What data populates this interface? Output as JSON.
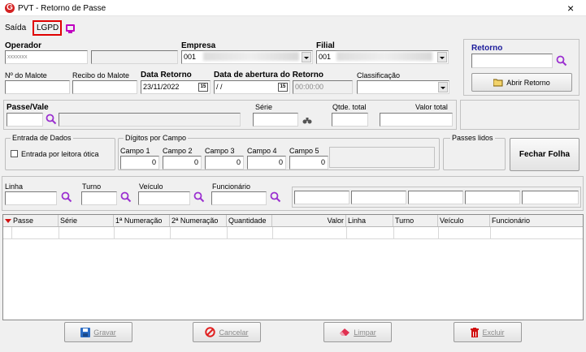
{
  "window": {
    "title": "PVT - Retorno de Passe",
    "close": "×"
  },
  "menu": {
    "saida": "Saída",
    "lgpd": "LGPD"
  },
  "operador": {
    "label": "Operador",
    "value": "xxxxxxx"
  },
  "empresa": {
    "label": "Empresa",
    "value": "001"
  },
  "filial": {
    "label": "Filial",
    "value": "001"
  },
  "retorno": {
    "label": "Retorno",
    "button": "Abrir Retorno"
  },
  "malote": {
    "label": "Nº do Malote"
  },
  "recibo": {
    "label": "Recibo do Malote"
  },
  "data_retorno": {
    "label": "Data Retorno",
    "value": "23/11/2022",
    "cal": "15"
  },
  "data_abertura": {
    "label": "Data de abertura do Retorno",
    "date": " / /",
    "time": "00:00:00",
    "cal": "15"
  },
  "classificacao": {
    "label": "Classificação"
  },
  "passe": {
    "label": "Passe/Vale"
  },
  "serie": {
    "label": "Série"
  },
  "qtde": {
    "label": "Qtde. total"
  },
  "valor": {
    "label": "Valor total"
  },
  "entrada": {
    "title": "Entrada de Dados",
    "checkbox": "Entrada por leitora ótica"
  },
  "digitos": {
    "title": "Dígitos por Campo",
    "campos": [
      {
        "label": "Campo 1",
        "value": "0"
      },
      {
        "label": "Campo 2",
        "value": "0"
      },
      {
        "label": "Campo 3",
        "value": "0"
      },
      {
        "label": "Campo 4",
        "value": "0"
      },
      {
        "label": "Campo 5",
        "value": "0"
      }
    ]
  },
  "passes_lidos": {
    "title": "Passes lidos"
  },
  "fechar": {
    "label": "Fechar Folha"
  },
  "filtros": {
    "linha": "Linha",
    "turno": "Turno",
    "veiculo": "Veículo",
    "funcionario": "Funcionário"
  },
  "grid": {
    "columns": [
      "Passe",
      "Série",
      "1ª Numeração",
      "2ª Numeração",
      "Quantidade",
      "Valor",
      "Linha",
      "Turno",
      "Veículo",
      "Funcionário"
    ]
  },
  "actions": {
    "gravar": "Gravar",
    "cancelar": "Cancelar",
    "limpar": "Limpar",
    "excluir": "Excluir"
  },
  "colors": {
    "accent": "#1a1a9a",
    "lgpd_border": "#e00000",
    "icon_magenta": "#c000c0",
    "search": "#9b30d0"
  }
}
